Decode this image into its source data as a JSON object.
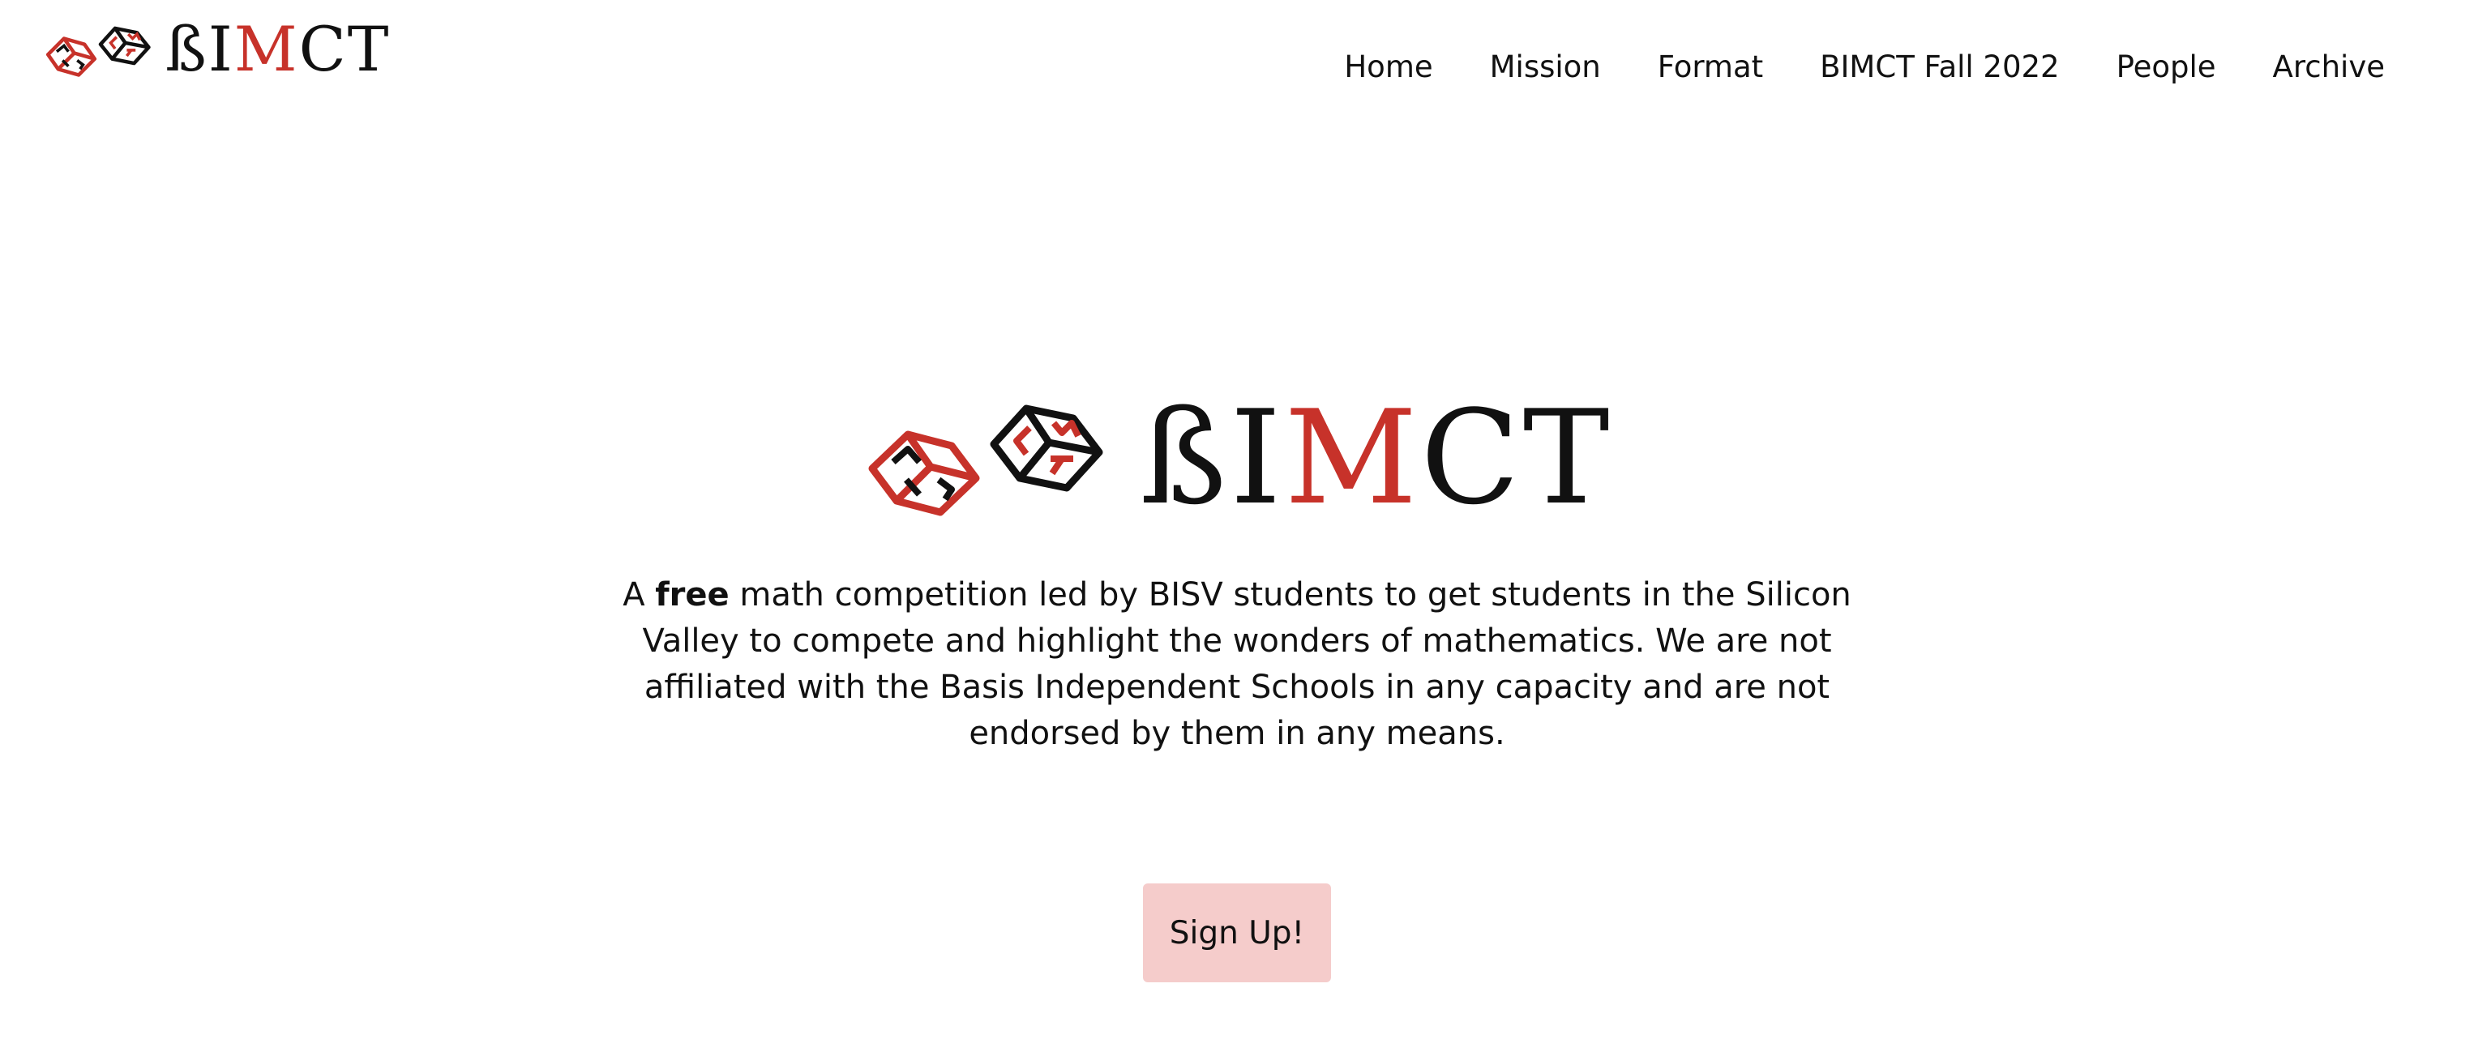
{
  "brand": {
    "word_prefix": "ßI",
    "word_m": "M",
    "word_suffix": "CT",
    "accent_color": "#c7322a"
  },
  "nav": {
    "items": [
      {
        "label": "Home"
      },
      {
        "label": "Mission"
      },
      {
        "label": "Format"
      },
      {
        "label": "BIMCT Fall 2022"
      },
      {
        "label": "People"
      },
      {
        "label": "Archive"
      }
    ]
  },
  "hero": {
    "word_prefix": "ßI",
    "word_m": "M",
    "word_suffix": "CT",
    "tagline_before": "A ",
    "tagline_bold": "free",
    "tagline_after": " math competition led by BISV students to get students in the Silicon Valley to compete and highlight the wonders of mathematics. We are not affiliated with the Basis Independent Schools in any capacity and are not endorsed by them in any means.",
    "signup_label": "Sign Up!",
    "signup_color": "#f5cccb"
  },
  "icons": {
    "logo_cubes": "logo-cubes-icon"
  }
}
